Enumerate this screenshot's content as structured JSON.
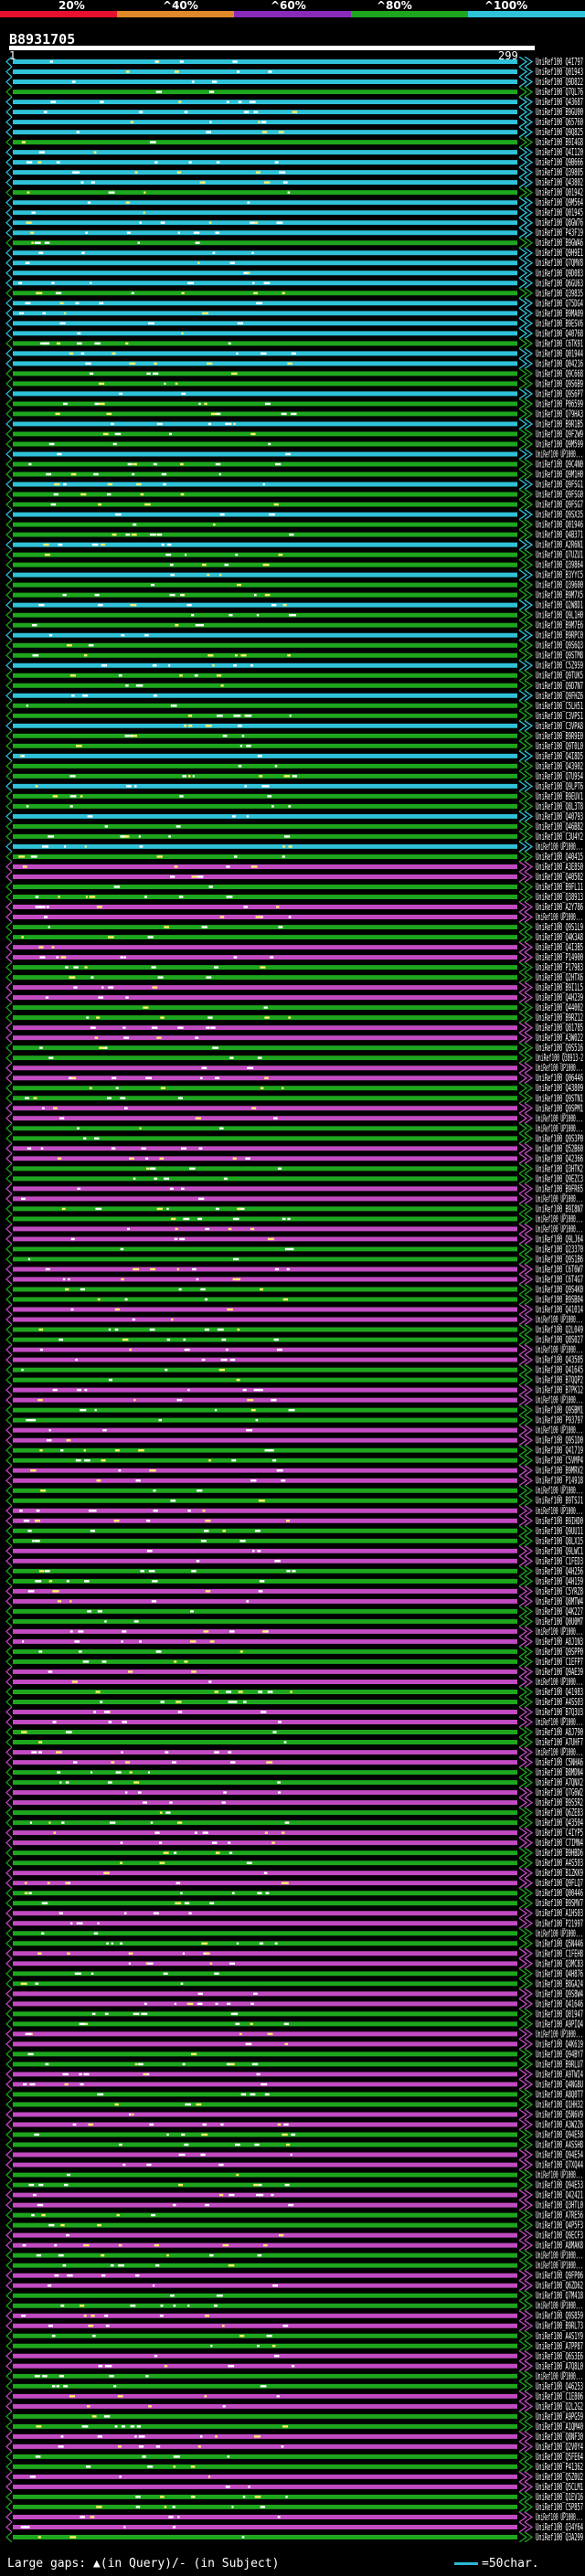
{
  "scale": {
    "ticks": [
      "20%",
      "^40%",
      "^60%",
      "^80%",
      "^100%"
    ],
    "colors": [
      "#e8112d",
      "#e0892a",
      "#8a2ab8",
      "#1ea61e",
      "#2fc2d8"
    ]
  },
  "query": {
    "id": "B8931705",
    "start": "1",
    "end": "299"
  },
  "legend": {
    "gaps_text": "Large gaps: ▲(in Query)/- (in Subject)",
    "scale_text": "=50char."
  },
  "hits": [
    "UniRef100_Q4I797",
    "UniRef100_Q01943",
    "UniRef100_Q9D822",
    "UniRef100_Q7QL76",
    "UniRef100_Q43687",
    "UniRef100_B9GU00",
    "UniRef100_Q65760",
    "UniRef100_Q9Q825",
    "UniRef100_B9I4G8",
    "UniRef100_Q4I120",
    "UniRef100_Q9B666",
    "UniRef100_Q39805",
    "UniRef100_Q43802",
    "UniRef100_Q01942",
    "UniRef100_Q9M564",
    "UniRef100_Q01945",
    "UniRef100_Q8GW76",
    "UniRef100_P43F19",
    "UniRef100_B9GWA6",
    "UniRef100_Q9H9E1",
    "UniRef100_Q7QMV8",
    "UniRef100_Q9D083",
    "UniRef100_Q6GU63",
    "UniRef100_Q39835",
    "UniRef100_Q75DG4",
    "UniRef100_B9MA09",
    "UniRef100_B9ESV6",
    "UniRef100_Q40768",
    "UniRef100_C6TK91",
    "UniRef100_Q01944",
    "UniRef100_Q04216",
    "UniRef100_Q9C668",
    "UniRef100_Q9S6B9",
    "UniRef100_Q9S6P7",
    "UniRef100_P06599",
    "UniRef100_Q79HA3",
    "UniRef100_B9R1B5",
    "UniRef100_Q9F2W9",
    "UniRef100_Q9M599",
    "UniRef100_UP1000...",
    "UniRef100_Q9C4N0",
    "UniRef100_Q9M1H0",
    "UniRef100_Q9FSG1",
    "UniRef100_Q9FSG0",
    "UniRef100_Q9FSG7",
    "UniRef100_Q9SX35",
    "UniRef100_Q01946",
    "UniRef100_Q4B371",
    "UniRef100_A2R6N1",
    "UniRef100_Q7UZU1",
    "UniRef100_Q39864",
    "UniRef100_B3YYC5",
    "UniRef100_Q39600",
    "UniRef100_B9M7X5",
    "UniRef100_Q2W8D1",
    "UniRef100_Q9L1H0",
    "UniRef100_B9M7E6",
    "UniRef100_B9RPC0",
    "UniRef100_Q9S6Q3",
    "UniRef100_Q9STM8",
    "UniRef100_C5Z9S9",
    "UniRef100_Q9TUK5",
    "UniRef100_Q9D7N7",
    "UniRef100_Q9FHZ6",
    "UniRef100_C5LH51",
    "UniRef100_C3VPS1",
    "UniRef100_C3VPA8",
    "UniRef100_B9R9E0",
    "UniRef100_Q9T0L0",
    "UniRef100_Q4I8D5",
    "UniRef100_Q43902",
    "UniRef100_Q7U9S4",
    "UniRef100_Q9LPT6",
    "UniRef100_B9EUV1",
    "UniRef100_Q8L3T8",
    "UniRef100_Q40793",
    "UniRef100_Q46B82",
    "UniRef100_C3U4Y2",
    "UniRef100_UP1000...",
    "UniRef100_Q40415",
    "UniRef100_A3E8S0",
    "UniRef100_Q40502",
    "UniRef100_B9FL11",
    "UniRef100_Q38913",
    "UniRef100_A2Y786",
    "UniRef100_UP1000...",
    "UniRef100_Q9S1L9",
    "UniRef100_Q4K3A8",
    "UniRef100_Q4I3B5",
    "UniRef100_P14900",
    "UniRef100_P17983",
    "UniRef100_Q2HTX6",
    "UniRef100_B9I1L5",
    "UniRef100_Q4H239",
    "UniRef100_Q44002",
    "UniRef100_B9RZ12",
    "UniRef100_Q81785",
    "UniRef100_A3W022",
    "UniRef100_Q9S516",
    "UniRef100_Q38913-2",
    "UniRef100_UP1000...",
    "UniRef100_Q06446",
    "UniRef100_Q43809",
    "UniRef100_Q9STN1",
    "UniRef100_Q9SPM1",
    "UniRef100_UP1000...",
    "UniRef100_UP1000...",
    "UniRef100_Q9S3P0",
    "UniRef100_Q52B60",
    "UniRef100_Q42366",
    "UniRef100_Q3HTK2",
    "UniRef100_Q9EZC3",
    "UniRef100_B9FR65",
    "UniRef100_UP1000...",
    "UniRef100_B9I8N7",
    "UniRef100_UP1000...",
    "UniRef100_UP1000...",
    "UniRef100_Q9LJ64",
    "UniRef100_Q23370",
    "UniRef100_Q9S1B6",
    "UniRef100_C6T6W7",
    "UniRef100_C6T4G7",
    "UniRef100_Q9S4K0",
    "UniRef100_B9SB04",
    "UniRef100_Q41014",
    "UniRef100_UP1000...",
    "UniRef100_Q2L049",
    "UniRef100_Q8S027",
    "UniRef100_UP1000...",
    "UniRef100_Q43505",
    "UniRef100_Q41645",
    "UniRef100_B7QQP2",
    "UniRef100_B7PK12",
    "UniRef100_UP1000...",
    "UniRef100_Q9SBM1",
    "UniRef100_P93797",
    "UniRef100_UP1000...",
    "UniRef100_Q9S1D0",
    "UniRef100_Q41719",
    "UniRef100_C5VMP4",
    "UniRef100_B9MRV2",
    "UniRef100_P14918",
    "UniRef100_UP1000...",
    "UniRef100_B9TSJ1",
    "UniRef100_UP1000...",
    "UniRef100_B9IHD0",
    "UniRef100_Q9UU11",
    "UniRef100_Q8LX15",
    "UniRef100_Q9LWC1",
    "UniRef100_C1FED3",
    "UniRef100_Q4H256",
    "UniRef100_Q4H159",
    "UniRef100_C5YRZ8",
    "UniRef100_Q8MTW4",
    "UniRef100_Q4K227",
    "UniRef100_Q0U0M7",
    "UniRef100_UP1000...",
    "UniRef100_A8J1N3",
    "UniRef100_Q9SPP0",
    "UniRef100_C1EFP7",
    "UniRef100_Q9AE39",
    "UniRef100_UP1000...",
    "UniRef100_Q41983",
    "UniRef100_A4SS03",
    "UniRef100_B7Q3U3",
    "UniRef100_UP1000...",
    "UniRef100_A8J790",
    "UniRef100_A7UHF7",
    "UniRef100_UP1000...",
    "UniRef100_C5NHA6",
    "UniRef100_B8MDN4",
    "UniRef100_A7QNX2",
    "UniRef100_Q7G6W2",
    "UniRef100_B9S5R2",
    "UniRef100_Q6ZE83",
    "UniRef100_Q43504",
    "UniRef100_C4IYP5",
    "UniRef100_C7IMN4",
    "UniRef100_B9HBD6",
    "UniRef100_A4S503",
    "UniRef100_B1ZKK9",
    "UniRef100_Q9FLQ7",
    "UniRef100_Q00446",
    "UniRef100_B9SMV7",
    "UniRef100_A1HS03",
    "UniRef100_P21997",
    "UniRef100_UP1000...",
    "UniRef100_Q5N446",
    "UniRef100_C1FEH8",
    "UniRef100_Q3MC83",
    "UniRef100_Q4H876",
    "UniRef100_B8GA24",
    "UniRef100_Q9S8W4",
    "UniRef100_Q41646",
    "UniRef100_Q01947",
    "UniRef100_A9PIQ4",
    "UniRef100_UP1000...",
    "UniRef100_Q4K619",
    "UniRef100_Q94BY7",
    "UniRef100_B9RLU7",
    "UniRef100_A9TWI4",
    "UniRef100_Q4NG8U",
    "UniRef100_A8Q0T7",
    "UniRef100_Q1HH32",
    "UniRef100_Q5N6V9",
    "UniRef100_A3W2Z6",
    "UniRef100_Q94E58",
    "UniRef100_A4SSH8",
    "UniRef100_Q94E54",
    "UniRef100_Q7XQ44",
    "UniRef100_UP1000...",
    "UniRef100_Q94E53",
    "UniRef100_Q42421",
    "UniRef100_Q3HTL0",
    "UniRef100_A7RE56",
    "UniRef100_Q4P5F3",
    "UniRef100_Q9ECF3",
    "UniRef100_A8MAK8",
    "UniRef100_UP1000...",
    "UniRef100_UP1000...",
    "UniRef100_Q9FP06",
    "UniRef100_Q6ZD62",
    "UniRef100_Q7M418",
    "UniRef100_UP1000...",
    "UniRef100_Q9S859",
    "UniRef100_B9RL73",
    "UniRef100_A4S1Y9",
    "UniRef100_A7PP87",
    "UniRef100_Q6S3E6",
    "UniRef100_A7Q8L0",
    "UniRef100_UP1000...",
    "UniRef100_Q46253",
    "UniRef100_C1E806",
    "UniRef100_Q2L2G2",
    "UniRef100_A9PG59",
    "UniRef100_A1QM40",
    "UniRef100_Q8NF30",
    "UniRef100_Q2V0Y4",
    "UniRef100_Q5FE64",
    "UniRef100_P41362",
    "UniRef100_Q5Z0U2",
    "UniRef100_Q5CLM1",
    "UniRef100_Q1EV16",
    "UniRef100_C5P857",
    "UniRef100_UP1000...",
    "UniRef100_Q34Y64",
    "UniRef100_Q3A299"
  ]
}
